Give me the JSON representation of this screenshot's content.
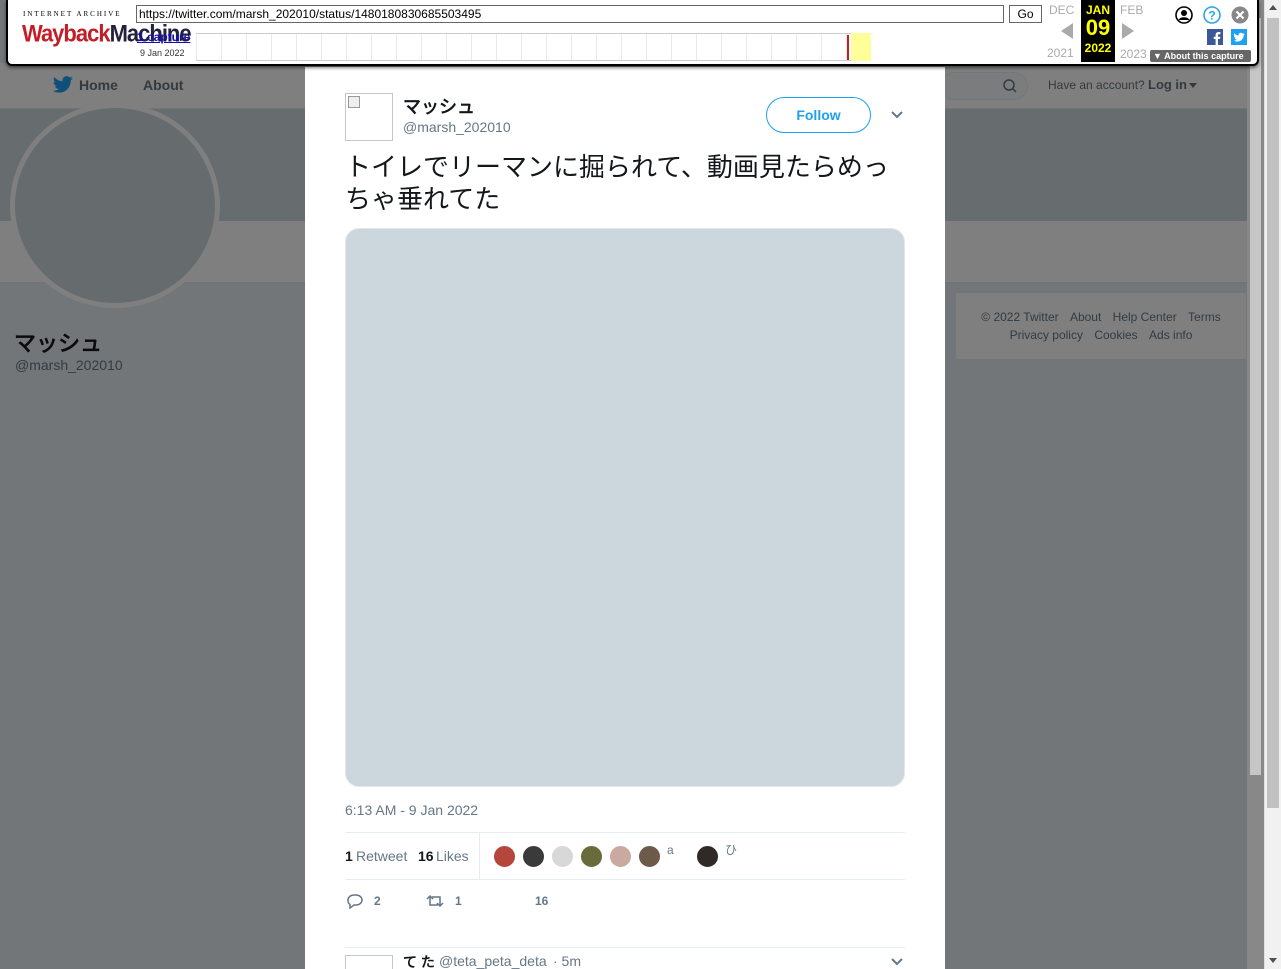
{
  "twitter": {
    "nav": {
      "home": "Home",
      "about": "About",
      "have_account": "Have an account?",
      "login": "Log in"
    },
    "profile": {
      "name": "マッシュ",
      "handle": "@marsh_202010"
    },
    "footer": {
      "row1": [
        "© 2022 Twitter",
        "About",
        "Help Center",
        "Terms"
      ],
      "row2": [
        "Privacy policy",
        "Cookies",
        "Ads info"
      ]
    }
  },
  "tweet": {
    "name": "マッシュ",
    "handle": "@marsh_202010",
    "follow_label": "Follow",
    "text": "トイレでリーマンに掘られて、動画見たらめっちゃ垂れてた",
    "timestamp": "6:13 AM - 9 Jan 2022",
    "retweets": {
      "count": "1",
      "label": "Retweet"
    },
    "likes": {
      "count": "16",
      "label": "Likes"
    },
    "liker_colors": [
      "#b5463c",
      "#3a3a3a",
      "#d8d8d8",
      "#6b6a3a",
      "#c9a9a0",
      "#6d5a48",
      "#2f2a28"
    ],
    "liker_broken": [
      "a",
      "ひ"
    ],
    "actions": {
      "replies": "2",
      "retweets": "1",
      "likes": "16"
    }
  },
  "reply": {
    "name": "て た",
    "handle": "@teta_peta_deta",
    "time": "· 5m"
  },
  "wayback": {
    "ia_label": "INTERNET ARCHIVE",
    "logo_a": "Wayback",
    "logo_b": "Machine",
    "url": "https://twitter.com/marsh_202010/status/1480180830685503495",
    "go": "Go",
    "captures": "1 capture",
    "capture_date": "9 Jan 2022",
    "prev_month": "DEC",
    "prev_year": "2021",
    "cur_month": "JAN",
    "cur_day": "09",
    "cur_year": "2022",
    "next_month": "FEB",
    "next_year": "2023",
    "about_capture": "▼ About this capture"
  },
  "colors": {
    "twitter_blue": "#1da1f2",
    "wayback_red": "#c31e28",
    "current_date_yellow": "#ffff00"
  }
}
